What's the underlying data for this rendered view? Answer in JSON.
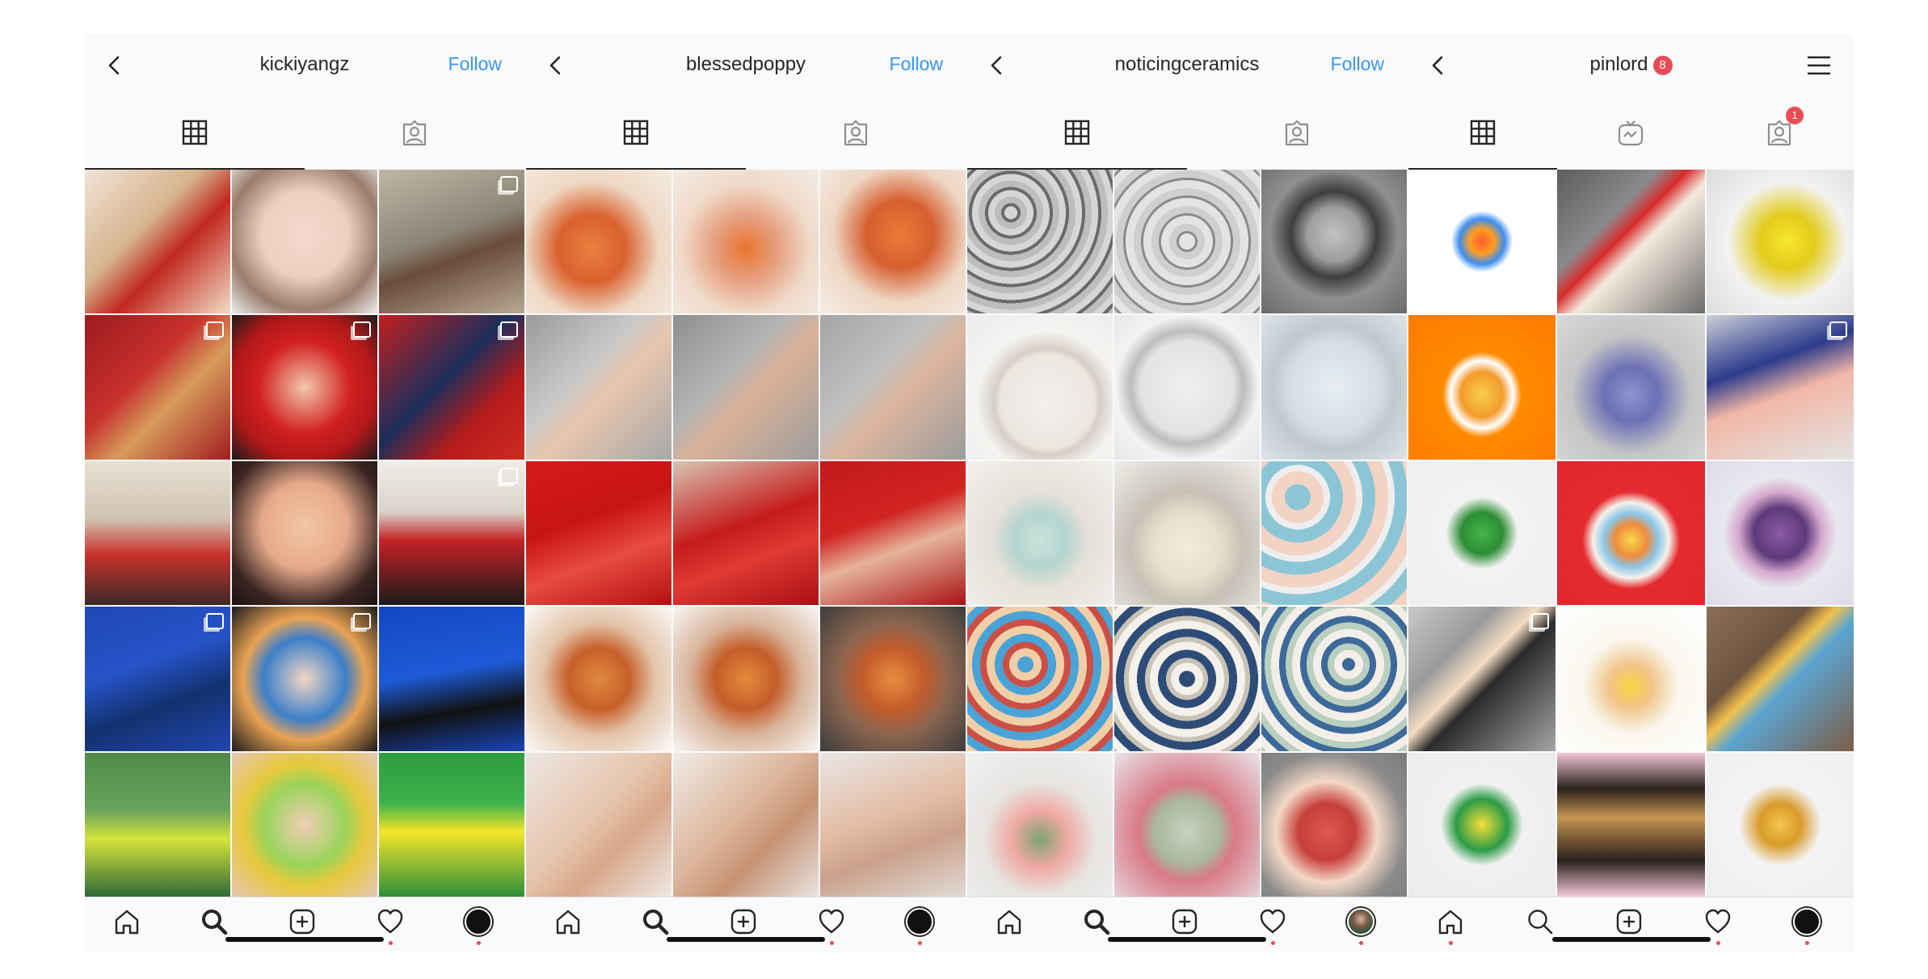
{
  "colors": {
    "link": "#3897f0",
    "badge": "#ed4956",
    "text": "#262626"
  },
  "icons": {
    "back": "chevron-left-icon",
    "grid": "grid-icon",
    "tagged": "tagged-person-icon",
    "igtv": "igtv-icon",
    "home": "home-icon",
    "search": "search-icon",
    "add": "add-post-icon",
    "heart": "heart-icon",
    "menu": "hamburger-menu-icon"
  },
  "panels": [
    {
      "username": "kickiyangz",
      "follow_label": "Follow",
      "tiles": [
        {
          "bg": "linear-gradient(135deg,#f1e4d6 0%,#d6b38e 40%,#c2281e 60%,#f2dcc6 100%)",
          "ms": false
        },
        {
          "bg": "radial-gradient(circle at 50% 45%,#f4d9cc 0%,#ecd0c2 40%,#9a7c6c 70%,#eee 100%)",
          "ms": false
        },
        {
          "bg": "linear-gradient(160deg,#bfb7a5 0%,#8b8576 45%,#6a4c3b 60%,#b8a994 100%)",
          "ms": true
        },
        {
          "bg": "linear-gradient(135deg,#9e1a1f 0%,#c7302d 40%,#d79b5b 60%,#a21d20 100%)",
          "ms": true
        },
        {
          "bg": "radial-gradient(circle at 50% 50%,#f1c7ad 0%,#d2201f 45%,#b1181a 70%,#1c1c1c 100%)",
          "ms": true
        },
        {
          "bg": "linear-gradient(135deg,#c41f1d 0%,#1c2e5a 45%,#b51b1b 70%,#d02b22 100%)",
          "ms": true
        },
        {
          "bg": "linear-gradient(180deg,#e9e0d2 0%,#cfc3b1 40%,#c9322b 65%,#3b2a26 100%)",
          "ms": false
        },
        {
          "bg": "radial-gradient(circle at 50% 45%,#f2c6a6 0%,#e6a98a 40%,#3a2522 75%,#1d1412 100%)",
          "ms": false
        },
        {
          "bg": "linear-gradient(180deg,#f0ece6 0%,#d9d3cb 35%,#c52125 55%,#1b1b1b 100%)",
          "ms": true
        },
        {
          "bg": "linear-gradient(160deg,#1f48b6 0%,#2653c8 40%,#13316f 65%,#2146b0 100%)",
          "ms": true
        },
        {
          "bg": "radial-gradient(circle at 50% 50%,#f2d7c3 0%,#3d7fc9 40%,#e9a354 60%,#1a1a1a 100%)",
          "ms": true
        },
        {
          "bg": "linear-gradient(170deg,#1446c4 0%,#1e5bd8 45%,#111 70%,#1846b9 100%)",
          "ms": false
        },
        {
          "bg": "linear-gradient(180deg,#4f8a4a 0%,#6aa35c 40%,#d6e33c 60%,#2f6a36 100%)",
          "ms": false
        },
        {
          "bg": "radial-gradient(circle at 50% 50%,#f0cdb6 0%,#9bd45a 40%,#e7c83c 60%,#e6c7b6 100%)",
          "ms": false
        },
        {
          "bg": "linear-gradient(180deg,#2e9c3d 0%,#3db24b 35%,#f4e62a 55%,#2d8f39 100%)",
          "ms": false
        }
      ]
    },
    {
      "username": "blessedpoppy",
      "follow_label": "Follow",
      "tiles": [
        {
          "bg": "radial-gradient(circle at 45% 55%,#e9803f 0%,#d9612d 30%,#efd8c4 60%,#f4ebe2 100%)",
          "ms": false
        },
        {
          "bg": "radial-gradient(circle at 50% 55%,#e8742e 0%,#e6a080 30%,#f0dac9 60%,#f3ece5 100%)",
          "ms": false
        },
        {
          "bg": "radial-gradient(circle at 55% 45%,#eb7b36 0%,#d65f30 30%,#eed6c3 60%,#f6eee7 100%)",
          "ms": false
        },
        {
          "bg": "linear-gradient(135deg,#9a9a9a 0%,#c9c9c9 40%,#e8c6ae 55%,#a7a7a7 100%)",
          "ms": false
        },
        {
          "bg": "linear-gradient(135deg,#8f8f8f 0%,#b4b4b4 40%,#d9b197 55%,#9d9d9d 100%)",
          "ms": false
        },
        {
          "bg": "linear-gradient(135deg,#a5a5a5 0%,#c0c0c0 40%,#dcb59e 55%,#9c9c9c 100%)",
          "ms": false
        },
        {
          "bg": "linear-gradient(160deg,#d31b1b 0%,#c91414 40%,#e84b3f 65%,#b50f12 100%)",
          "ms": false
        },
        {
          "bg": "linear-gradient(160deg,#d8c4b3 0%,#c61b1b 45%,#e03a33 65%,#ab0f13 100%)",
          "ms": false
        },
        {
          "bg": "linear-gradient(160deg,#c3191b 0%,#d12421 40%,#e6b39a 60%,#a91115 100%)",
          "ms": false
        },
        {
          "bg": "radial-gradient(circle at 50% 50%,#e0893d 0%,#c7602a 30%,#e3c3a8 55%,#fafafa 100%)",
          "ms": false
        },
        {
          "bg": "radial-gradient(circle at 50% 50%,#e48a3a 0%,#c45d2a 30%,#d9b49a 55%,#f7f7f7 100%)",
          "ms": false
        },
        {
          "bg": "radial-gradient(circle at 50% 50%,#e88e3f 0%,#c45c2b 30%,#8a6550 55%,#3c3c3c 100%)",
          "ms": false
        },
        {
          "bg": "linear-gradient(135deg,#ece6e1 0%,#e6c6ad 45%,#d8a78a 65%,#efe9e4 100%)",
          "ms": false
        },
        {
          "bg": "linear-gradient(135deg,#f0ebe6 0%,#dcb59b 45%,#c69274 65%,#e9e3de 100%)",
          "ms": false
        },
        {
          "bg": "linear-gradient(160deg,#e9e7e6 0%,#e3bba2 45%,#caa08a 65%,#e0dbd6 100%)",
          "ms": false
        }
      ]
    },
    {
      "username": "noticingceramics",
      "follow_label": "Follow",
      "tiles": [
        {
          "bg": "repeating-radial-gradient(circle at 30% 30%,#d6d6d6 0 8px,#6a6a6a 8px 12px,#bdbdbd 12px 20px)",
          "ms": false
        },
        {
          "bg": "repeating-radial-gradient(circle at 50% 50%,#e3e3e3 0 10px,#8b8b8b 10px 13px,#cfcfcf 13px 22px)",
          "ms": false
        },
        {
          "bg": "radial-gradient(circle at 50% 45%,#c2c2c2 0%,#9d9d9d 25%,#3e3e3e 40%,#8f8f8f 60%,#6b6b6b 100%)",
          "ms": false
        },
        {
          "bg": "radial-gradient(circle at 55% 60%,#f3f0ed 0%,#ebe6e0 40%,#d6cfc6 45%,#f5f3f0 60%,#ececec 100%)",
          "ms": false
        },
        {
          "bg": "radial-gradient(circle at 50% 50%,#f0f0f0 0%,#e3e3e3 45%,#bdbdbd 55%,#f3f3f3 70%,#e6e6e6 100%)",
          "ms": false
        },
        {
          "bg": "radial-gradient(circle at 50% 50%,#e8eef2 0%,#d5dde3 45%,#bfc9cf 60%,#dfe4e8 100%)",
          "ms": false
        },
        {
          "bg": "radial-gradient(circle at 50% 55%,#c8e3dc 0%,#b6d5cf 25%,#e5e0d9 45%,#f3f1ee 100%)",
          "ms": false
        },
        {
          "bg": "radial-gradient(circle at 50% 60%,#f2ecd9 0%,#e6dfcb 30%,#c7c1b6 50%,#f0eeeb 100%)",
          "ms": false
        },
        {
          "bg": "repeating-radial-gradient(circle at 25% 25%,#8cc6d6 0 16px,#f3d3c4 16px 32px,#eeeeee 32px 40px)",
          "ms": false
        },
        {
          "bg": "repeating-radial-gradient(circle at 40% 40%,#4aa3d6 0 10px,#f0cfa8 10px 20px,#cc4f46 20px 28px)",
          "ms": false
        },
        {
          "bg": "repeating-radial-gradient(circle at 50% 50%,#2e4c78 0 10px,#f4f0ea 10px 20px,#c9c3b6 20px 26px)",
          "ms": false
        },
        {
          "bg": "repeating-radial-gradient(circle at 60% 40%,#3d6a9a 0 8px,#f3efe8 8px 18px,#b9cfc0 18px 26px)",
          "ms": false
        },
        {
          "bg": "radial-gradient(circle at 50% 60%,#7da36e 0%,#f0a9a3 25%,#e7e4e1 50%,#f1f1f1 100%)",
          "ms": false
        },
        {
          "bg": "radial-gradient(circle at 50% 55%,#c7d1c0 0%,#a9b89c 30%,#d87a86 45%,#e9e4ea 100%)",
          "ms": false
        },
        {
          "bg": "radial-gradient(circle at 45% 55%,#e2584f 0%,#c63f3a 25%,#f3d8c6 45%,#8b8b8b 70%,#7a7a7a 100%)",
          "ms": false
        }
      ]
    },
    {
      "username": "pinlord",
      "username_badge": "8",
      "tiles": [
        {
          "bg": "radial-gradient(circle at 50% 50%,#ff5b2e 0%,#ff9e22 12%,#3b8ef0 22%,#ffffff 30%)",
          "ms": false
        },
        {
          "bg": "linear-gradient(135deg,#5d5d5d 0%,#8a8a8a 35%,#d82b2b 45%,#f5e9dc 55%,#6b6b6b 100%)",
          "ms": false
        },
        {
          "bg": "radial-gradient(circle at 55% 50%,#f7e62e 0%,#e3cc1b 25%,#f2f2f2 55%,#dcdcdc 100%)",
          "ms": false
        },
        {
          "bg": "radial-gradient(ellipse at 50% 55%,#f6d04f 0%,#f49b2b 20%,#ffffff 30%,#ff8a00 38%,#ff7a00 100%)",
          "ms": false
        },
        {
          "bg": "radial-gradient(circle at 50% 55%,#8f93cf 0%,#6c70b5 25%,#c5c5c5 55%,#d9d9d9 100%)",
          "ms": false
        },
        {
          "bg": "linear-gradient(160deg,#cdd0d8 0%,#2c3b8c 35%,#f2b7a6 55%,#e3e3e3 100%)",
          "ms": true
        },
        {
          "bg": "radial-gradient(circle at 50% 50%,#44b649 0%,#2e8d34 20%,#f2f2f2 35%,#efefef 100%)",
          "ms": false
        },
        {
          "bg": "radial-gradient(circle at 50% 55%,#f7d94e 0%,#ef8c3b 15%,#8ac6e9 25%,#f5f1e9 35%,#e52b2f 45%,#e1252b 100%)",
          "ms": false
        },
        {
          "bg": "radial-gradient(ellipse at 50% 50%,#8e5aa8 0%,#5d3a7a 25%,#d6a8cd 40%,#e8e8ef 55%,#dcdce8 100%)",
          "ms": false
        },
        {
          "bg": "linear-gradient(135deg,#c9c9c9 0%,#9a9a9a 30%,#f4dcc3 45%,#2b2b2b 55%,#a5a5a5 100%)",
          "ms": true
        },
        {
          "bg": "radial-gradient(circle at 50% 55%,#f7d53e 0%,#f2c48b 20%,#f5e6c9 35%,#fbf7f0 45%,#ffffff 100%)",
          "ms": false
        },
        {
          "bg": "linear-gradient(135deg,#8d6e55 0%,#6e543f 35%,#f2c14e 45%,#5ba4d2 55%,#7b5d45 100%)",
          "ms": false
        },
        {
          "bg": "radial-gradient(circle at 50% 50%,#f6e03a 0%,#2d9b46 25%,#f1f1f1 40%,#ececec 100%)",
          "ms": false
        },
        {
          "bg": "linear-gradient(180deg,#f3c6d6 0%,#2b211d 25%,#c59452 45%,#2a201c 75%,#f4c9d8 100%)",
          "ms": false
        },
        {
          "bg": "radial-gradient(circle at 50% 50%,#f2c64d 0%,#d99a2a 20%,#f3f3f3 40%,#efefef 100%)",
          "ms": false
        }
      ],
      "tab_badge": "1"
    }
  ]
}
